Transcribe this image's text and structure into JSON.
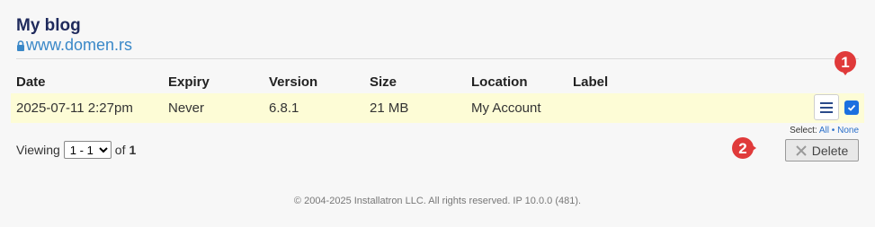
{
  "site": {
    "title": "My blog",
    "domain": "www.domen.rs"
  },
  "table": {
    "headers": {
      "date": "Date",
      "expiry": "Expiry",
      "version": "Version",
      "size": "Size",
      "location": "Location",
      "label": "Label"
    },
    "rows": [
      {
        "date": "2025-07-11 2:27pm",
        "expiry": "Never",
        "version": "6.8.1",
        "size": "21 MB",
        "location": "My Account",
        "label": "",
        "checked": true
      }
    ]
  },
  "pagination": {
    "prefix": "Viewing",
    "selected": "1 - 1",
    "of": "of",
    "total": "1"
  },
  "select": {
    "prefix": "Select:",
    "all": "All",
    "separator": "•",
    "none": "None"
  },
  "actions": {
    "delete_label": "Delete"
  },
  "annotations": {
    "marker_1": "1",
    "marker_2": "2"
  },
  "footer": {
    "text": "© 2004-2025 Installatron LLC. All rights reserved. IP 10.0.0 (481)."
  },
  "colors": {
    "title": "#1f2a5c",
    "link": "#3a88c8",
    "row_highlight": "#fdfcd6",
    "checkbox": "#1a6fe0",
    "marker": "#e03a3a"
  },
  "icons": {
    "domain": "lock-icon",
    "row_menu": "menu-icon",
    "checkbox": "check-icon",
    "delete": "close-icon"
  }
}
